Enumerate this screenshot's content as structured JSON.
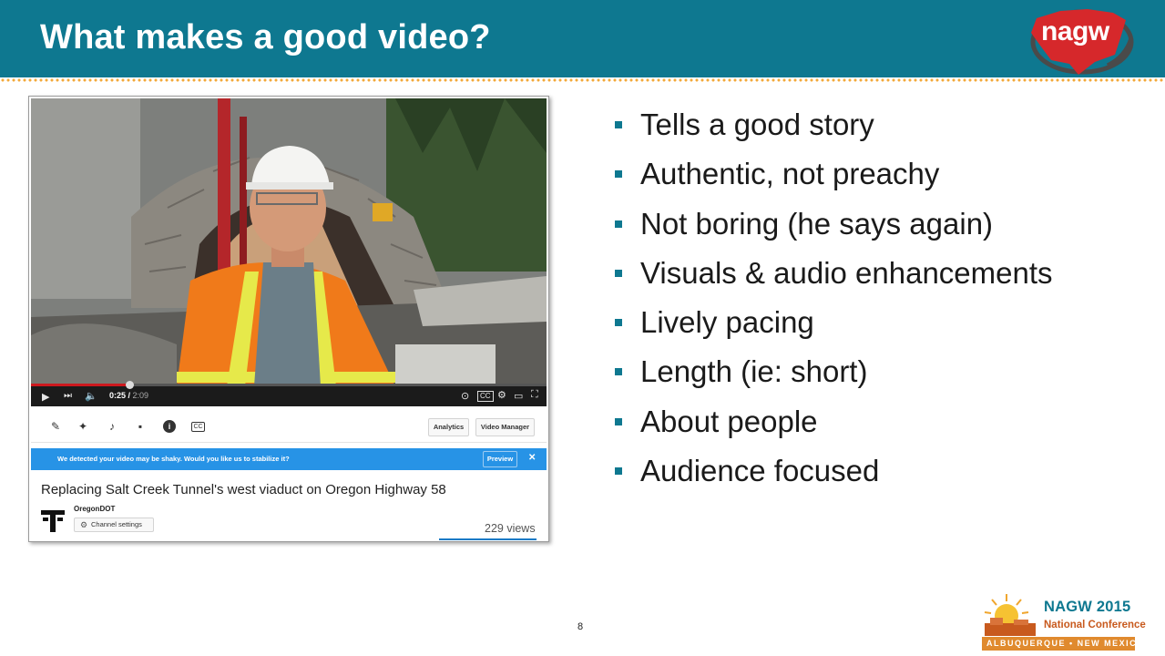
{
  "slide": {
    "title": "What makes a good video?",
    "logo_text": "nagw",
    "page_number": "8"
  },
  "video": {
    "current_time": "0:25",
    "duration": "2:09",
    "progress_fraction": 0.19,
    "toolbar": {
      "analytics_label": "Analytics",
      "video_manager_label": "Video Manager"
    },
    "notice": {
      "text": "We detected your video may be shaky. Would you like us to stabilize it?",
      "preview_label": "Preview",
      "close_label": "✕"
    },
    "title": "Replacing Salt Creek Tunnel's west viaduct on Oregon Highway 58",
    "channel_name": "OregonDOT",
    "channel_settings_label": "Channel settings",
    "views": "229 views"
  },
  "bullets": [
    "Tells a good story",
    "Authentic, not preachy",
    "Not boring (he says again)",
    "Visuals & audio enhancements",
    "Lively pacing",
    "Length (ie: short)",
    "About people",
    "Audience focused"
  ],
  "conference": {
    "title": "NAGW 2015",
    "subtitle": "National Conference",
    "location": "ALBUQUERQUE • NEW MEXICO"
  },
  "colors": {
    "header": "#0e7890",
    "accent_dots": "#f2a93b",
    "logo_red": "#d6282b",
    "youtube_red": "#cc181e",
    "notice_blue": "#2793e6"
  }
}
